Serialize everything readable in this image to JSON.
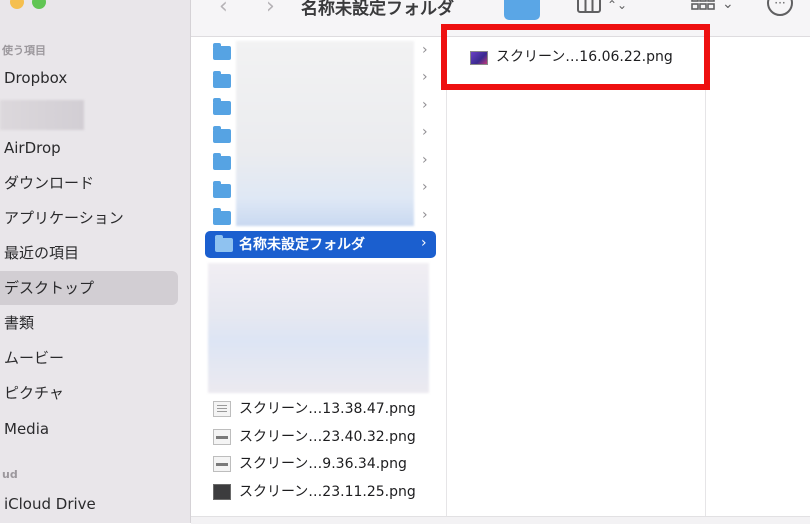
{
  "window": {
    "title": "名称未設定フォルダ"
  },
  "sidebar": {
    "section_favorites": "使う項目",
    "section_icloud": "ud",
    "items": [
      {
        "label": "Dropbox"
      },
      {
        "label": "AirDrop"
      },
      {
        "label": "ダウンロード"
      },
      {
        "label": "アプリケーション"
      },
      {
        "label": "最近の項目"
      },
      {
        "label": "デスクトップ",
        "selected": true
      },
      {
        "label": "書類"
      },
      {
        "label": "ムービー"
      },
      {
        "label": "ピクチャ"
      },
      {
        "label": "Media"
      },
      {
        "label": "iCloud Drive"
      }
    ]
  },
  "toolbar": {
    "back_glyph": "‹",
    "forward_glyph": "›",
    "view_icon": "column-view-icon",
    "view_chevron": "⌃⌄",
    "group_icon": "grid-view-icon",
    "group_chevron": "⌄",
    "more_glyph": "···"
  },
  "column1": {
    "selected_folder": "名称未設定フォルダ",
    "files": [
      {
        "name": "スクリーン…13.38.47.png",
        "thumb": "lines"
      },
      {
        "name": "スクリーン…23.40.32.png",
        "thumb": "bar"
      },
      {
        "name": "スクリーン…9.36.34.png",
        "thumb": "bar"
      },
      {
        "name": "スクリーン…23.11.25.png",
        "thumb": "dark"
      }
    ]
  },
  "column2": {
    "files": [
      {
        "name": "スクリーン…16.06.22.png"
      }
    ]
  },
  "colors": {
    "selection_blue": "#1b5fcf",
    "folder_blue": "#56a3e3",
    "highlight_red": "#ee1010",
    "sidebar_bg": "#e9e6ea"
  }
}
